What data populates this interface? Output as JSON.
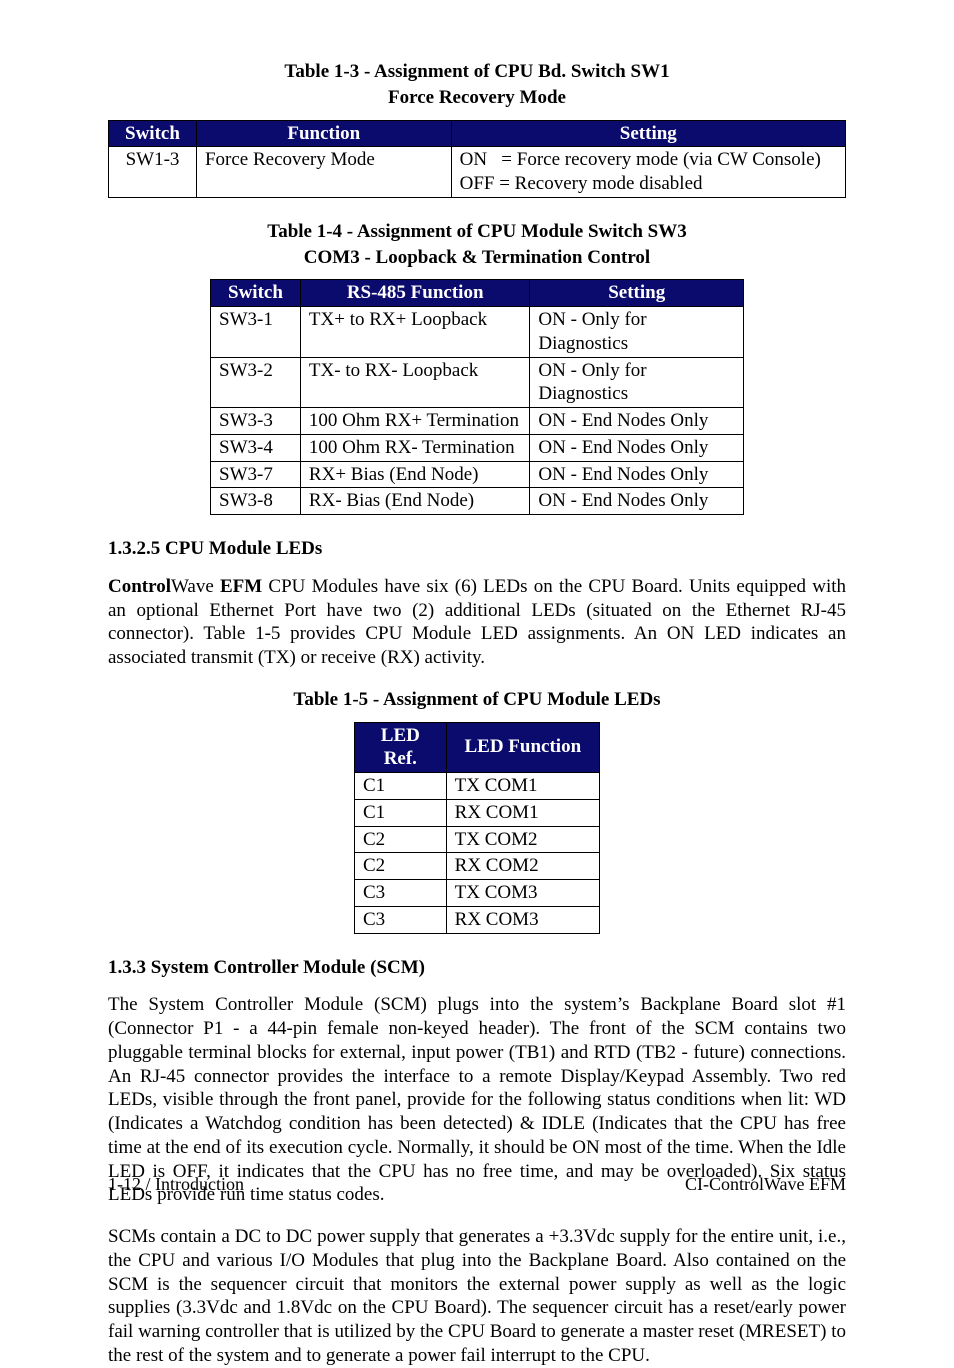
{
  "table13": {
    "caption": "Table 1-3 - Assignment of CPU Bd. Switch SW1",
    "subcaption": "Force Recovery Mode",
    "headers": [
      "Switch",
      "Function",
      "Setting"
    ],
    "rows": [
      {
        "switch": "SW1-3",
        "function": "Force Recovery Mode",
        "setting_on": "ON   = Force recovery mode (via CW Console)",
        "setting_off": "OFF = Recovery mode disabled"
      }
    ]
  },
  "table14": {
    "caption": "Table 1-4 - Assignment of CPU Module Switch SW3",
    "subcaption": "COM3 - Loopback & Termination Control",
    "headers": [
      "Switch",
      "RS-485 Function",
      "Setting"
    ],
    "rows": [
      {
        "switch": "SW3-1",
        "func": "TX+ to RX+ Loopback",
        "setting": "ON - Only for Diagnostics"
      },
      {
        "switch": "SW3-2",
        "func": "TX- to RX- Loopback",
        "setting": "ON - Only for Diagnostics"
      },
      {
        "switch": "SW3-3",
        "func": "100 Ohm RX+ Termination",
        "setting": "ON - End Nodes Only"
      },
      {
        "switch": "SW3-4",
        "func": "100 Ohm RX- Termination",
        "setting": "ON - End Nodes Only"
      },
      {
        "switch": "SW3-7",
        "func": "RX+ Bias (End Node)",
        "setting": "ON - End Nodes Only"
      },
      {
        "switch": "SW3-8",
        "func": "RX- Bias (End Node)",
        "setting": "ON - End Nodes Only"
      }
    ]
  },
  "section1325": {
    "heading": "1.3.2.5  CPU Module LEDs",
    "para_pre_b1": "Control",
    "para_mid1": "Wave ",
    "para_b2": "EFM",
    "para_rest": " CPU Modules have six (6) LEDs on the CPU Board. Units equipped with an optional Ethernet Port have two (2) additional LEDs (situated on the Ethernet RJ-45 connector). Table 1-5 provides CPU Module LED assignments. An ON LED indicates an associated transmit (TX) or receive (RX) activity."
  },
  "table15": {
    "caption": "Table 1-5 - Assignment of CPU Module LEDs",
    "headers": [
      "LED Ref.",
      "LED Function"
    ],
    "rows": [
      {
        "ref": "C1",
        "func": "TX COM1"
      },
      {
        "ref": "C1",
        "func": "RX COM1"
      },
      {
        "ref": "C2",
        "func": "TX COM2"
      },
      {
        "ref": "C2",
        "func": "RX COM2"
      },
      {
        "ref": "C3",
        "func": "TX COM3"
      },
      {
        "ref": "C3",
        "func": "RX COM3"
      }
    ]
  },
  "section133": {
    "heading": "1.3.3  System Controller Module (SCM)",
    "para1": "The System Controller Module (SCM) plugs into the system’s Backplane Board slot #1 (Connector P1 - a 44-pin female non-keyed header). The front of the SCM contains two pluggable terminal blocks for external, input power (TB1) and RTD (TB2 - future) connections. An RJ-45 connector provides the interface to a remote Display/Keypad Assembly. Two red LEDs, visible through the front panel, provide for the following status conditions when lit: WD (Indicates a Watchdog condition has been detected) & IDLE (Indicates that the CPU has free time at the end of its execution cycle. Normally, it should be ON most of the time. When the Idle LED is OFF, it indicates that the CPU has no free time, and may be overloaded). Six status LEDs provide run time status codes.",
    "para2": "SCMs contain a DC to DC power supply that generates a +3.3Vdc supply for the entire unit, i.e., the CPU and various I/O Modules that plug into the Backplane Board. Also contained on the SCM is the sequencer circuit that monitors the external power supply as well as the logic supplies (3.3Vdc and 1.8Vdc on the CPU Board). The sequencer circuit has a reset/early power fail warning controller that is utilized by the CPU Board to generate a master reset (MRESET) to the rest of the system and to generate a power fail interrupt to the CPU."
  },
  "footer": {
    "left": "1-12 / Introduction",
    "right": "CI-ControlWave EFM"
  }
}
